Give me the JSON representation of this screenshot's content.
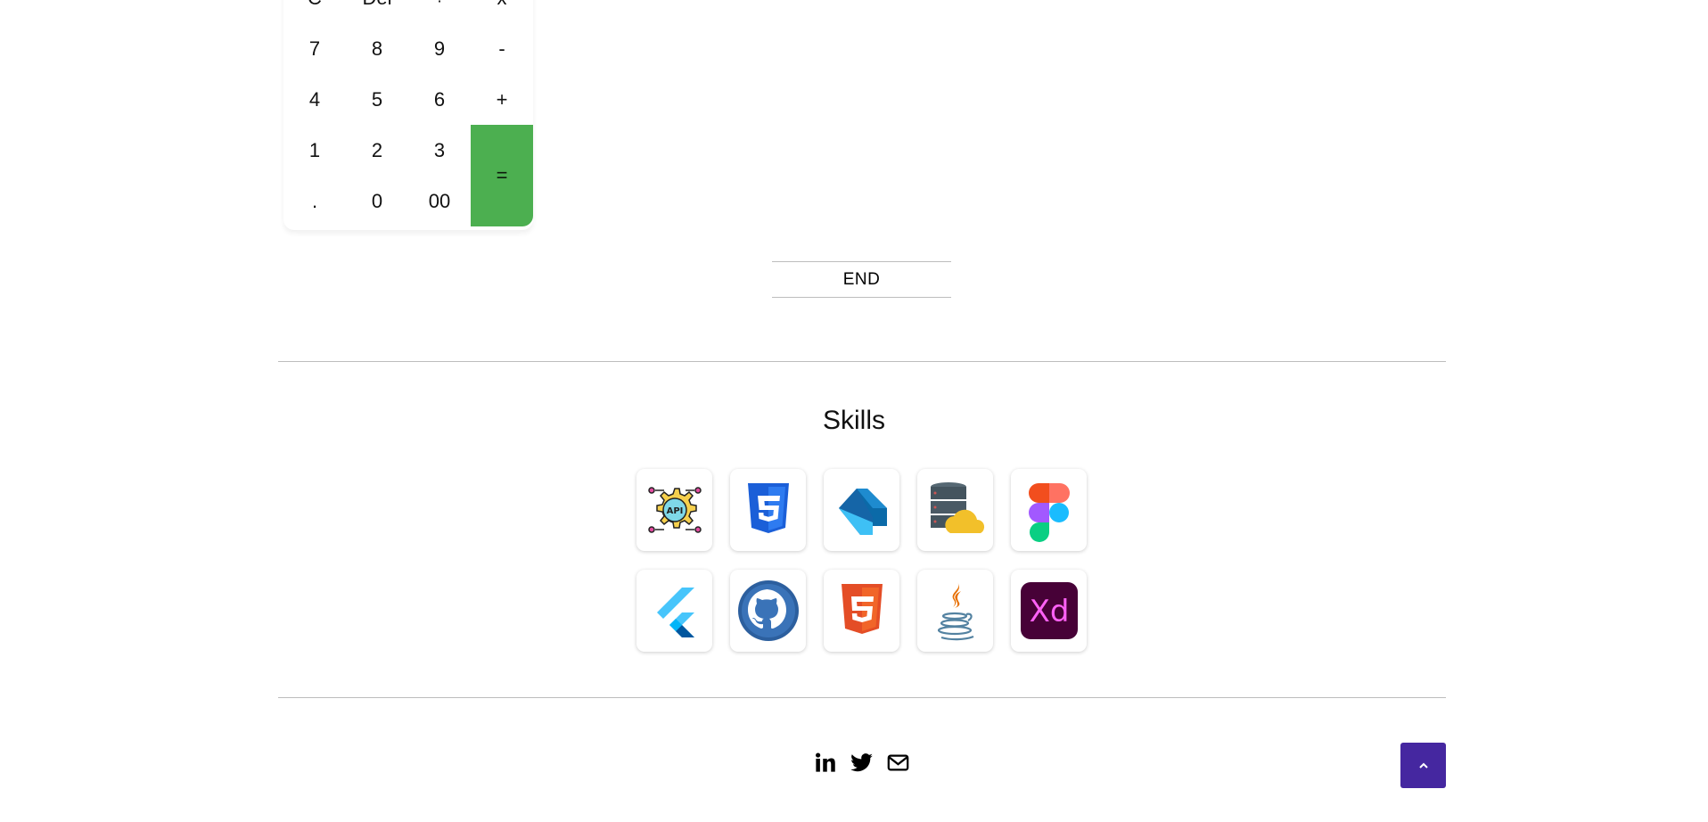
{
  "calculator": {
    "keys": [
      "C",
      "Del",
      "÷",
      "x",
      "7",
      "8",
      "9",
      "-",
      "4",
      "5",
      "6",
      "+",
      "1",
      "2",
      "3",
      "=",
      ".",
      "0",
      "00"
    ],
    "equals_color": "#4caf50"
  },
  "end_label": "END",
  "skills": {
    "title": "Skills",
    "icons": [
      "api-icon",
      "css3-icon",
      "dart-icon",
      "cloud-database-icon",
      "figma-icon",
      "flutter-icon",
      "github-icon",
      "html5-icon",
      "java-icon",
      "adobe-xd-icon"
    ]
  },
  "footer": {
    "social_icons": [
      "linkedin-icon",
      "twitter-icon",
      "email-icon"
    ],
    "back_to_top_icon": "chevron-up-icon",
    "back_to_top_color": "#4527a0"
  }
}
